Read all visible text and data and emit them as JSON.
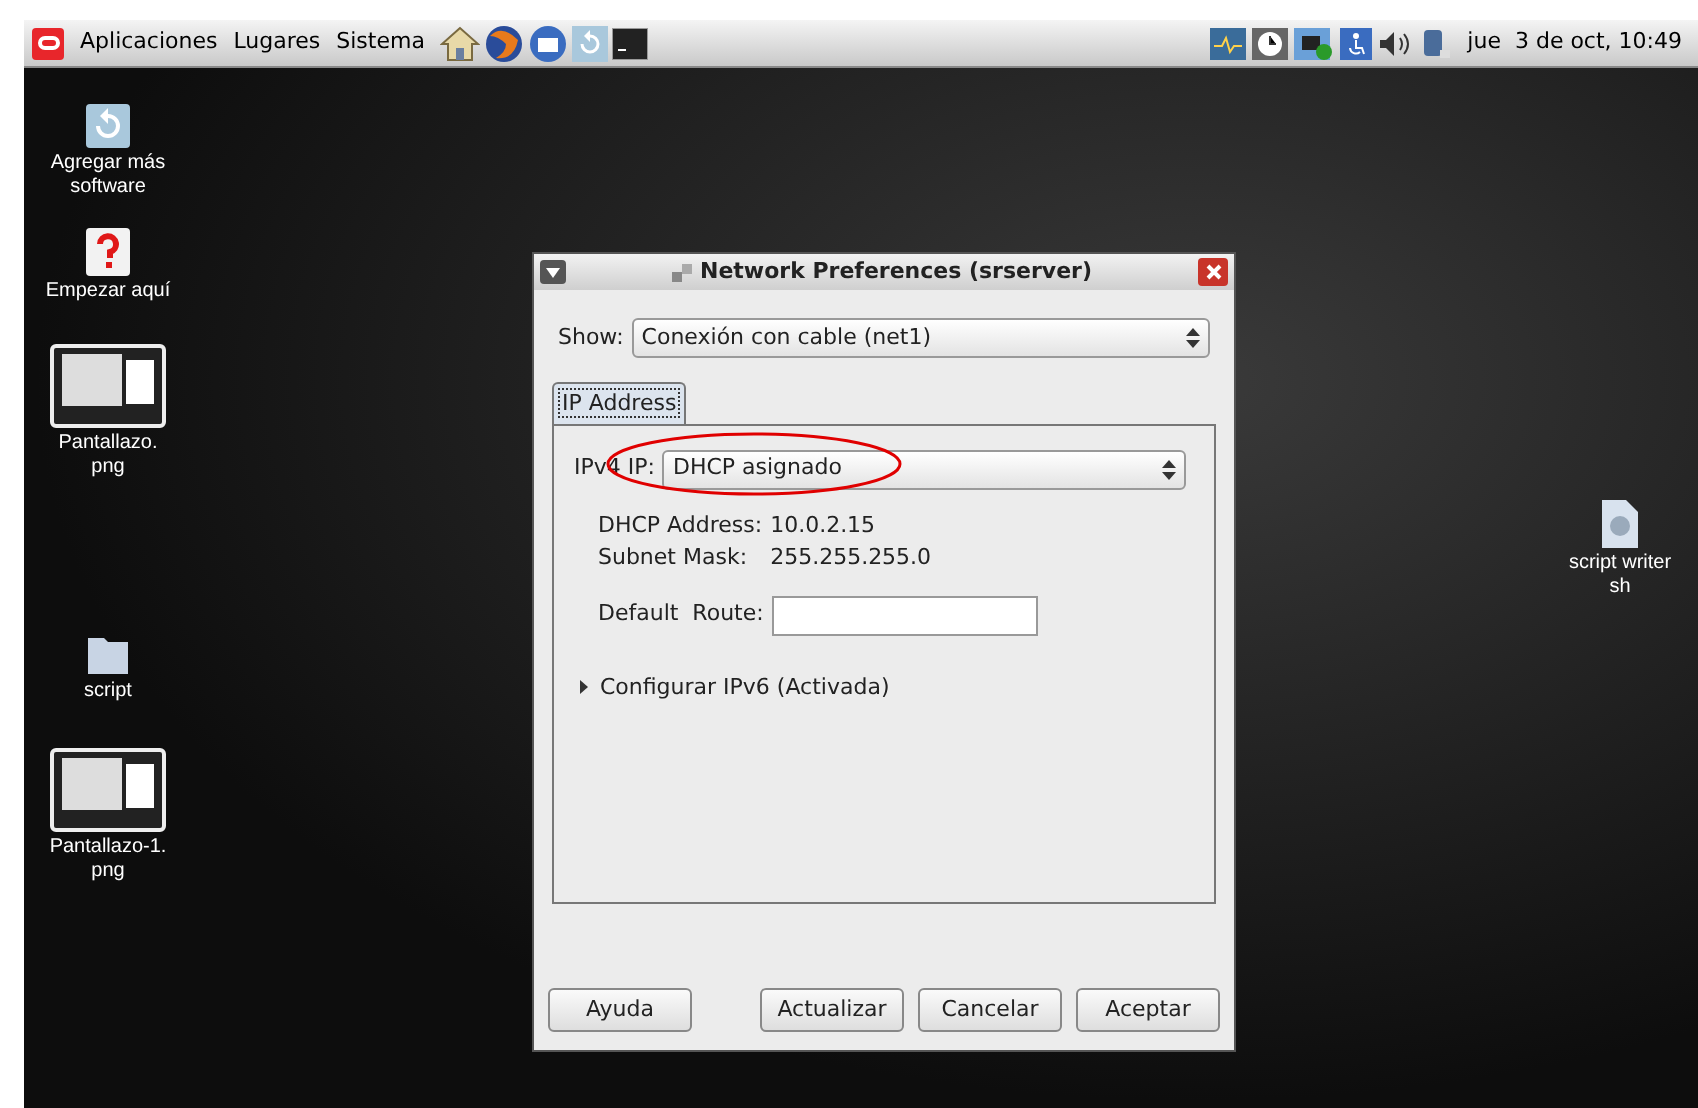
{
  "panel": {
    "menus": [
      "Aplicaciones",
      "Lugares",
      "Sistema"
    ],
    "launchers": [
      {
        "kind": "home"
      },
      {
        "kind": "browser"
      },
      {
        "kind": "mail"
      },
      {
        "kind": "update"
      },
      {
        "kind": "terminal"
      }
    ],
    "tray": [
      {
        "kind": "monitor"
      },
      {
        "kind": "clock"
      },
      {
        "kind": "network"
      },
      {
        "kind": "accessibility"
      },
      {
        "kind": "volume"
      },
      {
        "kind": "power"
      }
    ],
    "clock": "jue  3 de oct, 10:49"
  },
  "desktop_icons": [
    {
      "label": "Agregar más\nsoftware",
      "kind": "update"
    },
    {
      "label": "Empezar aquí",
      "kind": "help"
    },
    {
      "label": "Pantallazo.\npng",
      "kind": "image"
    },
    {
      "label": "script",
      "kind": "folder"
    },
    {
      "label": "Pantallazo-1.\npng",
      "kind": "image"
    },
    {
      "label": "script writer\nsh",
      "kind": "script"
    }
  ],
  "dialog": {
    "title": "Network Preferences (srserver)",
    "show": {
      "label": "Show:",
      "value": "Conexión con cable (net1)"
    },
    "tabs": [
      {
        "label": "IP Address",
        "selected": true
      }
    ],
    "ipv4": {
      "label": "IPv4 IP:",
      "value": "DHCP asignado"
    },
    "info": [
      {
        "label": "DHCP Address:",
        "value": "10.0.2.15"
      },
      {
        "label": "Subnet Mask:",
        "value": "255.255.255.0"
      }
    ],
    "default_route": {
      "label": "Default  Route:"
    },
    "ipv6_expander": {
      "label": "Configurar IPv6 (Activada)",
      "expanded": false
    },
    "buttons": [
      "Ayuda",
      "Actualizar",
      "Cancelar",
      "Aceptar"
    ]
  }
}
